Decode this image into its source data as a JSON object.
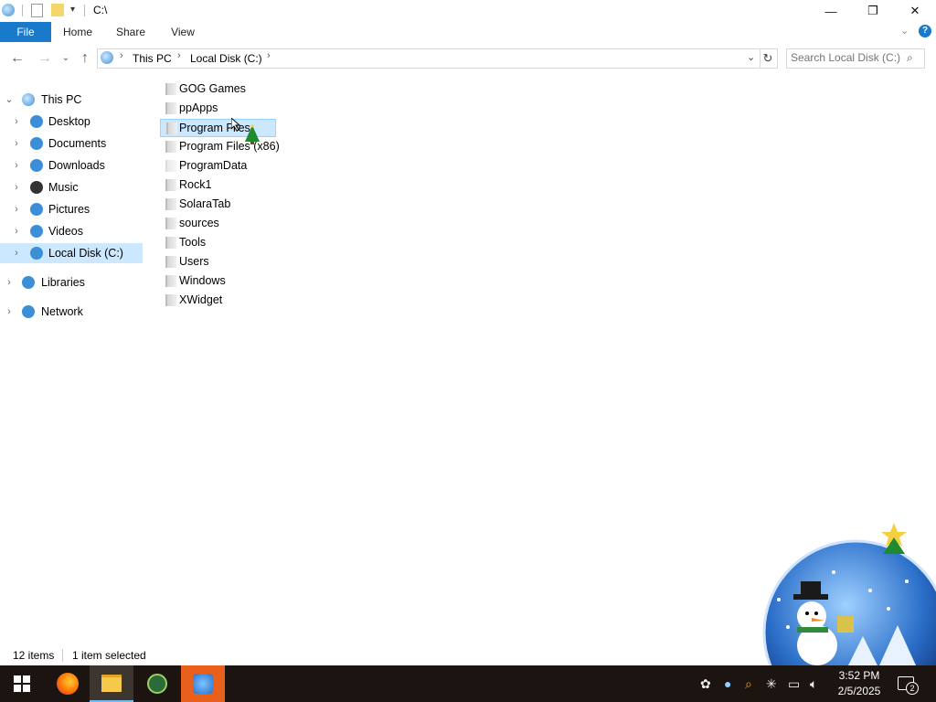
{
  "window": {
    "title": "C:\\",
    "controls": {
      "minimize": "—",
      "maximize": "❐",
      "close": "✕"
    }
  },
  "ribbon": {
    "tabs": [
      {
        "label": "File"
      },
      {
        "label": "Home"
      },
      {
        "label": "Share"
      },
      {
        "label": "View"
      }
    ],
    "help_icon": "?"
  },
  "address": {
    "breadcrumb": [
      "This PC",
      "Local Disk (C:)"
    ],
    "search_placeholder": "Search Local Disk (C:)"
  },
  "nav_pane": {
    "this_pc": "This PC",
    "this_pc_children": [
      {
        "label": "Desktop",
        "icon": "desktop-icon",
        "color": "#3c8fd6"
      },
      {
        "label": "Documents",
        "icon": "documents-icon",
        "color": "#3c8fd6"
      },
      {
        "label": "Downloads",
        "icon": "downloads-icon",
        "color": "#3c8fd6"
      },
      {
        "label": "Music",
        "icon": "music-icon",
        "color": "#333333"
      },
      {
        "label": "Pictures",
        "icon": "pictures-icon",
        "color": "#3c8fd6"
      },
      {
        "label": "Videos",
        "icon": "videos-icon",
        "color": "#3c8fd6"
      },
      {
        "label": "Local Disk (C:)",
        "icon": "disk-icon",
        "color": "#3c8fd6",
        "selected": true
      }
    ],
    "libraries": "Libraries",
    "network": "Network"
  },
  "files": [
    "GOG Games",
    "ppApps",
    "Program Files",
    "Program Files (x86)",
    "ProgramData",
    "Rock1",
    "SolaraTab",
    "sources",
    "Tools",
    "Users",
    "Windows",
    "XWidget"
  ],
  "selected_file": "Program Files",
  "status": {
    "item_count": "12 items",
    "selection": "1 item selected"
  },
  "taskbar": {
    "apps": [
      "start-icon",
      "firefox-icon",
      "file-explorer-icon",
      "gaming-app-icon",
      "desktop-widget-icon"
    ],
    "time": "3:52 PM",
    "date": "2/5/2025",
    "notification_count": "2"
  },
  "colors": {
    "accent": "#1979ca",
    "selection": "#cce8ff",
    "taskbar": "#1b1410"
  }
}
